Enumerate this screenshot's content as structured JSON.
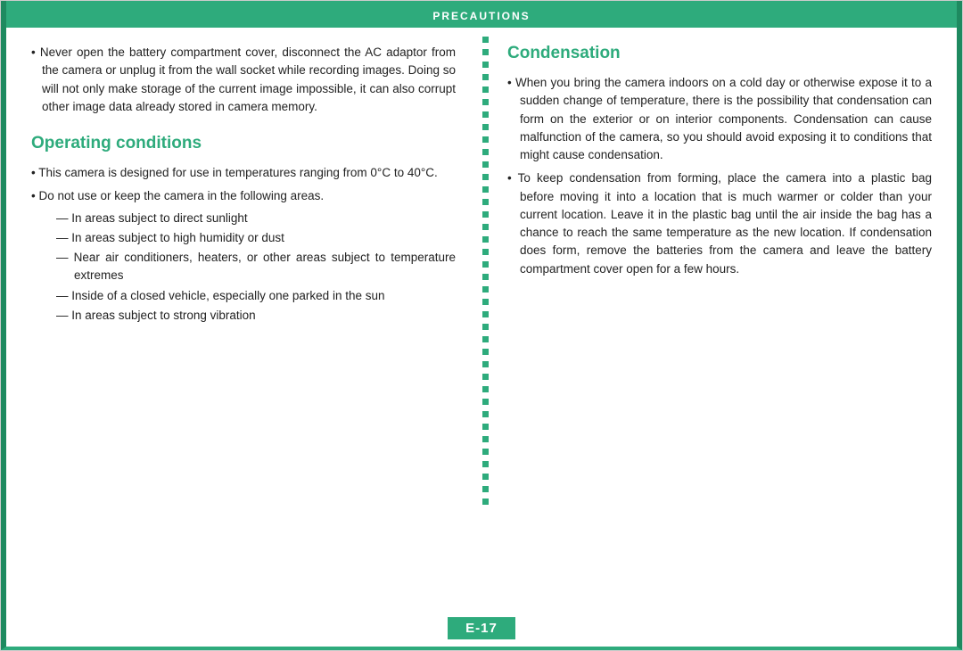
{
  "header": {
    "label": "PRECAUTIONS"
  },
  "left_column": {
    "intro_bullet": "Never open the battery compartment cover, disconnect the AC adaptor from the camera or unplug it from the wall socket while recording images. Doing so will not only make storage of the current image impossible, it can also corrupt other image data already stored in camera memory.",
    "section_heading": "Operating conditions",
    "bullets": [
      {
        "text": "This camera is designed for use in temperatures ranging from 0°C to 40°C.",
        "sub_items": []
      },
      {
        "text": "Do not use or keep the camera in the following areas.",
        "sub_items": [
          "In areas subject to direct sunlight",
          "In areas subject to high humidity or dust",
          "Near air conditioners, heaters, or other areas subject to temperature extremes",
          "Inside of a closed vehicle, especially one parked in the sun",
          "In areas subject to strong vibration"
        ]
      }
    ]
  },
  "right_column": {
    "section_heading": "Condensation",
    "bullets": [
      {
        "text": "When you bring the camera indoors on a cold day or otherwise expose it to a sudden change of temperature, there is the possibility that condensation can form on the exterior or on interior components. Condensation can cause malfunction of the camera, so you should avoid exposing it to conditions that might cause condensation."
      },
      {
        "text": "To keep condensation from forming, place the camera into a plastic bag before moving it into a location that is much warmer or colder than your current location. Leave it in the plastic bag until the air inside the bag has a chance to reach the same temperature as the new location. If condensation does form, remove the batteries from the camera and leave the battery compartment cover open for a few hours."
      }
    ]
  },
  "footer": {
    "page_number": "E-17"
  },
  "dots_count": 38
}
